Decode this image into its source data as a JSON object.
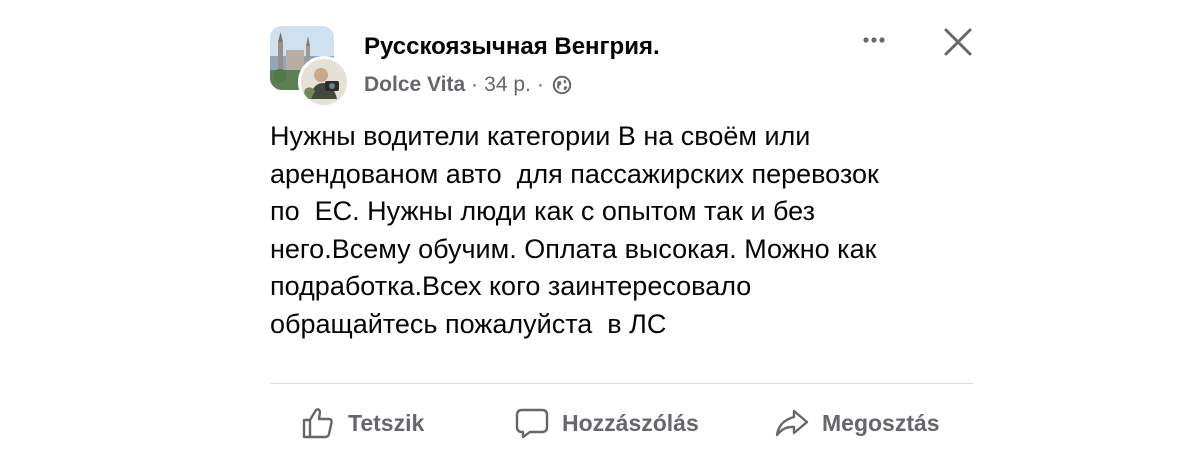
{
  "post": {
    "group_name": "Русскоязычная Венгрия.",
    "author_name": "Dolce Vita",
    "separator": "·",
    "timestamp": "34 р.",
    "privacy_icon": "globe-icon",
    "more_icon": "more-horizontal-icon",
    "close_icon": "close-icon",
    "body_lines": [
      "Нужны водители категории B на своём или",
      "арендованом авто  для пассажирских перевозок",
      "по  ЕС. Нужны люди как с опытом так и без",
      "него.Всему обучим. Оплата высокая. Можно как",
      "подработка.Всех кого заинтересовало",
      "обращайтесь пожалуйста  в ЛС"
    ]
  },
  "actions": {
    "like_label": "Tetszik",
    "comment_label": "Hozzászólás",
    "share_label": "Megosztás"
  },
  "colors": {
    "text_primary": "#050505",
    "text_secondary": "#65676b",
    "divider": "#d8dadf",
    "background": "#ffffff"
  }
}
